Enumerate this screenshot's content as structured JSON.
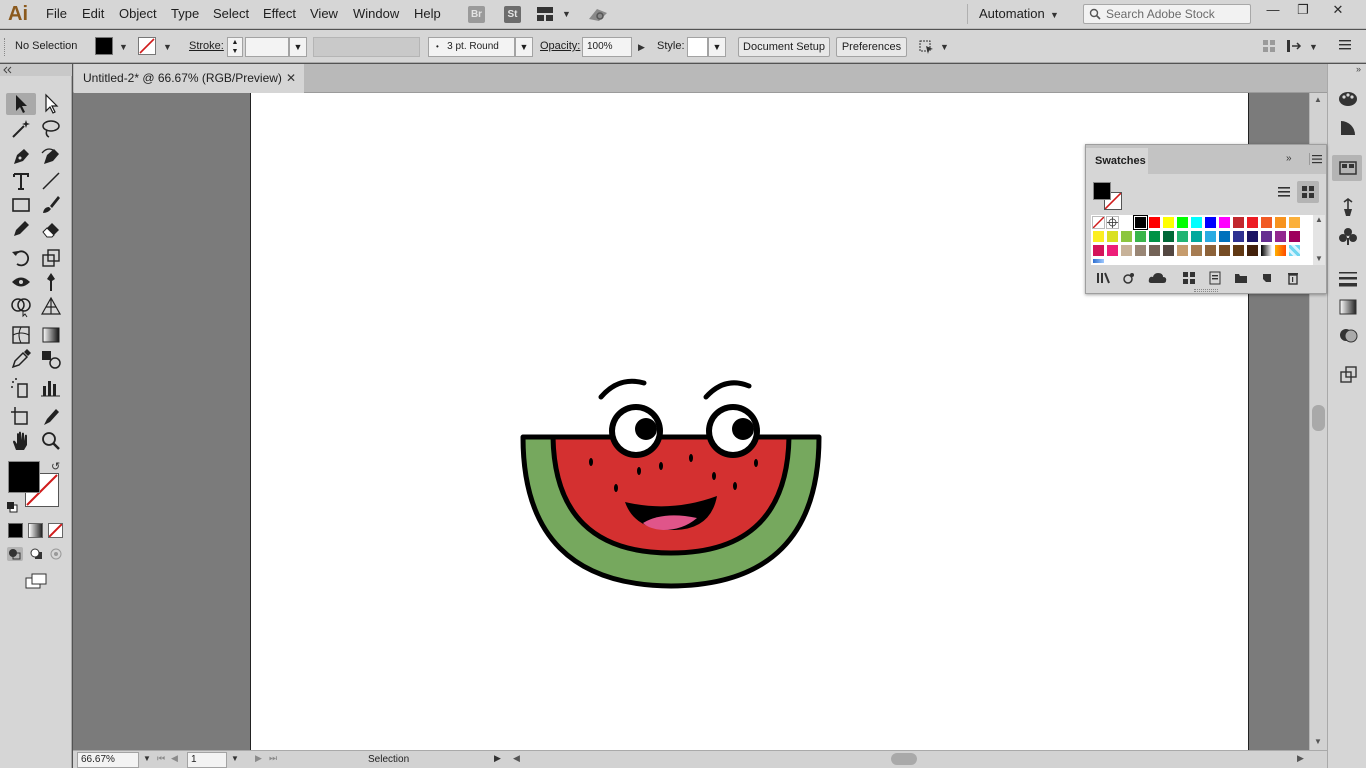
{
  "app": {
    "logo": "Ai",
    "menu": [
      "File",
      "Edit",
      "Object",
      "Type",
      "Select",
      "Effect",
      "View",
      "Window",
      "Help"
    ],
    "bridge_badge": "Br",
    "stock_badge": "St",
    "workspace": "Automation",
    "search_placeholder": "Search Adobe Stock",
    "window_buttons": {
      "minimize": "—",
      "restore": "❐",
      "close": "✕"
    }
  },
  "control": {
    "selection_label": "No Selection",
    "stroke_label": "Stroke:",
    "brush_value": "3 pt. Round",
    "opacity_label": "Opacity:",
    "opacity_value": "100%",
    "style_label": "Style:",
    "document_setup": "Document Setup",
    "preferences": "Preferences"
  },
  "document": {
    "tab_title": "Untitled-2* @ 66.67% (RGB/Preview)",
    "close": "✕"
  },
  "status": {
    "zoom": "66.67%",
    "artboard_number": "1",
    "current_tool": "Selection"
  },
  "swatches": {
    "panel_title": "Swatches",
    "row1": [
      "#ffffff",
      "#000000",
      "#ff0000",
      "#ffff00",
      "#00ff00",
      "#00ffff",
      "#0000ff",
      "#ff00ff",
      "#c1272d",
      "#ed1c24",
      "#f15a24",
      "#f7931e",
      "#fbb03b"
    ],
    "row2": [
      "#fcee21",
      "#d9e021",
      "#8cc63f",
      "#39b54a",
      "#009245",
      "#006837",
      "#22b573",
      "#00a99d",
      "#29abe2",
      "#0071bc",
      "#2e3192",
      "#1b1464",
      "#662d91",
      "#93278f",
      "#9e005d"
    ],
    "row3": [
      "#d4145a",
      "#ed1e79",
      "#c7b299",
      "#998675",
      "#736357",
      "#534741",
      "#c69c6d",
      "#a67c52",
      "#8c6239",
      "#754c24",
      "#603813",
      "#42210b"
    ],
    "colors": {
      "fill": "#000000",
      "stroke_none": "#d01c1c"
    }
  },
  "artwork": {
    "rind_color": "#76a85e",
    "flesh_color": "#d43030",
    "tongue_color": "#e0558a",
    "outline_color": "#000000"
  }
}
